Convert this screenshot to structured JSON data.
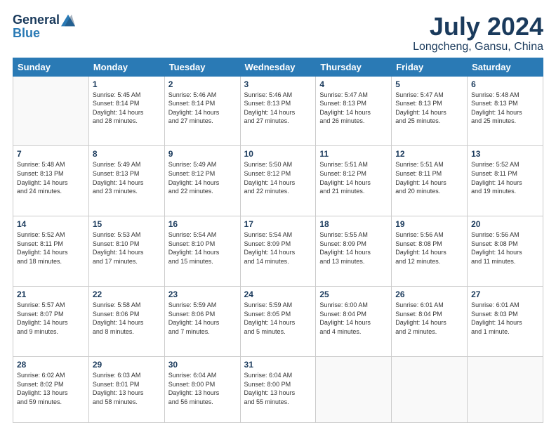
{
  "logo": {
    "general": "General",
    "blue": "Blue"
  },
  "title": "July 2024",
  "subtitle": "Longcheng, Gansu, China",
  "days_header": [
    "Sunday",
    "Monday",
    "Tuesday",
    "Wednesday",
    "Thursday",
    "Friday",
    "Saturday"
  ],
  "weeks": [
    [
      {
        "num": "",
        "info": ""
      },
      {
        "num": "1",
        "info": "Sunrise: 5:45 AM\nSunset: 8:14 PM\nDaylight: 14 hours\nand 28 minutes."
      },
      {
        "num": "2",
        "info": "Sunrise: 5:46 AM\nSunset: 8:14 PM\nDaylight: 14 hours\nand 27 minutes."
      },
      {
        "num": "3",
        "info": "Sunrise: 5:46 AM\nSunset: 8:13 PM\nDaylight: 14 hours\nand 27 minutes."
      },
      {
        "num": "4",
        "info": "Sunrise: 5:47 AM\nSunset: 8:13 PM\nDaylight: 14 hours\nand 26 minutes."
      },
      {
        "num": "5",
        "info": "Sunrise: 5:47 AM\nSunset: 8:13 PM\nDaylight: 14 hours\nand 25 minutes."
      },
      {
        "num": "6",
        "info": "Sunrise: 5:48 AM\nSunset: 8:13 PM\nDaylight: 14 hours\nand 25 minutes."
      }
    ],
    [
      {
        "num": "7",
        "info": "Sunrise: 5:48 AM\nSunset: 8:13 PM\nDaylight: 14 hours\nand 24 minutes."
      },
      {
        "num": "8",
        "info": "Sunrise: 5:49 AM\nSunset: 8:13 PM\nDaylight: 14 hours\nand 23 minutes."
      },
      {
        "num": "9",
        "info": "Sunrise: 5:49 AM\nSunset: 8:12 PM\nDaylight: 14 hours\nand 22 minutes."
      },
      {
        "num": "10",
        "info": "Sunrise: 5:50 AM\nSunset: 8:12 PM\nDaylight: 14 hours\nand 22 minutes."
      },
      {
        "num": "11",
        "info": "Sunrise: 5:51 AM\nSunset: 8:12 PM\nDaylight: 14 hours\nand 21 minutes."
      },
      {
        "num": "12",
        "info": "Sunrise: 5:51 AM\nSunset: 8:11 PM\nDaylight: 14 hours\nand 20 minutes."
      },
      {
        "num": "13",
        "info": "Sunrise: 5:52 AM\nSunset: 8:11 PM\nDaylight: 14 hours\nand 19 minutes."
      }
    ],
    [
      {
        "num": "14",
        "info": "Sunrise: 5:52 AM\nSunset: 8:11 PM\nDaylight: 14 hours\nand 18 minutes."
      },
      {
        "num": "15",
        "info": "Sunrise: 5:53 AM\nSunset: 8:10 PM\nDaylight: 14 hours\nand 17 minutes."
      },
      {
        "num": "16",
        "info": "Sunrise: 5:54 AM\nSunset: 8:10 PM\nDaylight: 14 hours\nand 15 minutes."
      },
      {
        "num": "17",
        "info": "Sunrise: 5:54 AM\nSunset: 8:09 PM\nDaylight: 14 hours\nand 14 minutes."
      },
      {
        "num": "18",
        "info": "Sunrise: 5:55 AM\nSunset: 8:09 PM\nDaylight: 14 hours\nand 13 minutes."
      },
      {
        "num": "19",
        "info": "Sunrise: 5:56 AM\nSunset: 8:08 PM\nDaylight: 14 hours\nand 12 minutes."
      },
      {
        "num": "20",
        "info": "Sunrise: 5:56 AM\nSunset: 8:08 PM\nDaylight: 14 hours\nand 11 minutes."
      }
    ],
    [
      {
        "num": "21",
        "info": "Sunrise: 5:57 AM\nSunset: 8:07 PM\nDaylight: 14 hours\nand 9 minutes."
      },
      {
        "num": "22",
        "info": "Sunrise: 5:58 AM\nSunset: 8:06 PM\nDaylight: 14 hours\nand 8 minutes."
      },
      {
        "num": "23",
        "info": "Sunrise: 5:59 AM\nSunset: 8:06 PM\nDaylight: 14 hours\nand 7 minutes."
      },
      {
        "num": "24",
        "info": "Sunrise: 5:59 AM\nSunset: 8:05 PM\nDaylight: 14 hours\nand 5 minutes."
      },
      {
        "num": "25",
        "info": "Sunrise: 6:00 AM\nSunset: 8:04 PM\nDaylight: 14 hours\nand 4 minutes."
      },
      {
        "num": "26",
        "info": "Sunrise: 6:01 AM\nSunset: 8:04 PM\nDaylight: 14 hours\nand 2 minutes."
      },
      {
        "num": "27",
        "info": "Sunrise: 6:01 AM\nSunset: 8:03 PM\nDaylight: 14 hours\nand 1 minute."
      }
    ],
    [
      {
        "num": "28",
        "info": "Sunrise: 6:02 AM\nSunset: 8:02 PM\nDaylight: 13 hours\nand 59 minutes."
      },
      {
        "num": "29",
        "info": "Sunrise: 6:03 AM\nSunset: 8:01 PM\nDaylight: 13 hours\nand 58 minutes."
      },
      {
        "num": "30",
        "info": "Sunrise: 6:04 AM\nSunset: 8:00 PM\nDaylight: 13 hours\nand 56 minutes."
      },
      {
        "num": "31",
        "info": "Sunrise: 6:04 AM\nSunset: 8:00 PM\nDaylight: 13 hours\nand 55 minutes."
      },
      {
        "num": "",
        "info": ""
      },
      {
        "num": "",
        "info": ""
      },
      {
        "num": "",
        "info": ""
      }
    ]
  ]
}
